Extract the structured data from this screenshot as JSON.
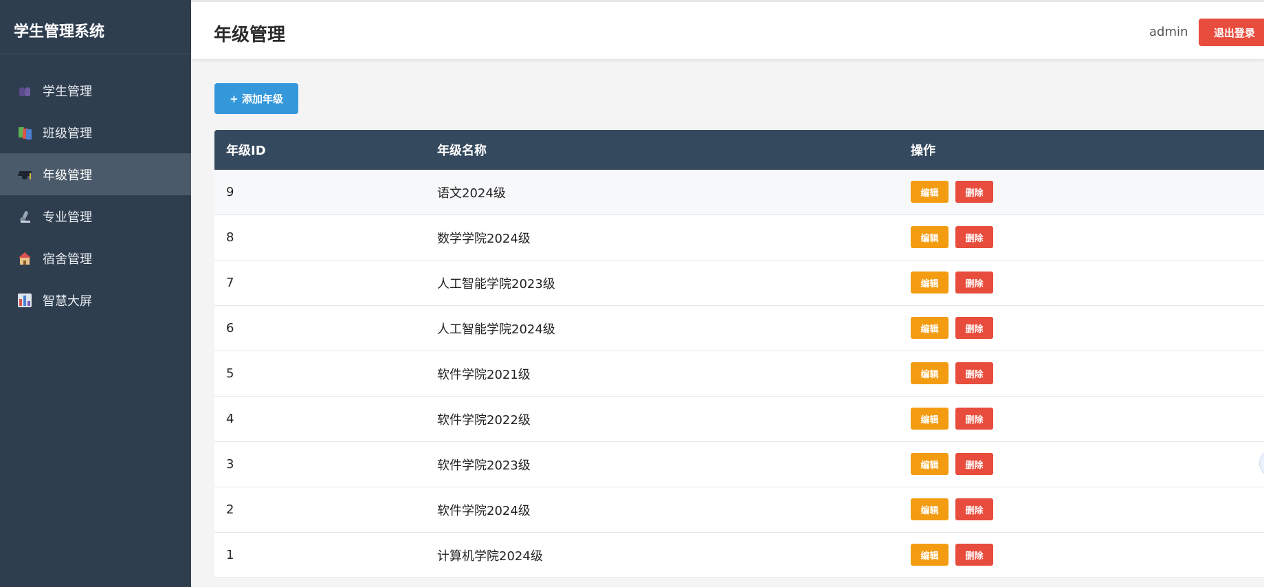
{
  "sidebar": {
    "title": "学生管理系统",
    "items": [
      {
        "label": "学生管理",
        "icon": "students-icon"
      },
      {
        "label": "班级管理",
        "icon": "books-icon"
      },
      {
        "label": "年级管理",
        "icon": "graduation-cap-icon",
        "active": true
      },
      {
        "label": "专业管理",
        "icon": "microscope-icon"
      },
      {
        "label": "宿舍管理",
        "icon": "house-icon"
      },
      {
        "label": "智慧大屏",
        "icon": "bar-chart-icon"
      }
    ]
  },
  "header": {
    "title": "年级管理",
    "user": "admin",
    "logout_label": "退出登录"
  },
  "toolbar": {
    "add_label": "+ 添加年级"
  },
  "table": {
    "columns": [
      "年级ID",
      "年级名称",
      "操作"
    ],
    "rows": [
      {
        "id": "9",
        "name": "语文2024级"
      },
      {
        "id": "8",
        "name": "数学学院2024级"
      },
      {
        "id": "7",
        "name": "人工智能学院2023级"
      },
      {
        "id": "6",
        "name": "人工智能学院2024级"
      },
      {
        "id": "5",
        "name": "软件学院2021级"
      },
      {
        "id": "4",
        "name": "软件学院2022级"
      },
      {
        "id": "3",
        "name": "软件学院2023级"
      },
      {
        "id": "2",
        "name": "软件学院2024级"
      },
      {
        "id": "1",
        "name": "计算机学院2024级"
      }
    ],
    "edit_label": "编辑",
    "delete_label": "删除"
  },
  "colors": {
    "sidebar_bg": "#2f3e4f",
    "header_table_bg": "#34495e",
    "primary": "#3498db",
    "edit": "#f39c12",
    "danger": "#e74c3c"
  }
}
